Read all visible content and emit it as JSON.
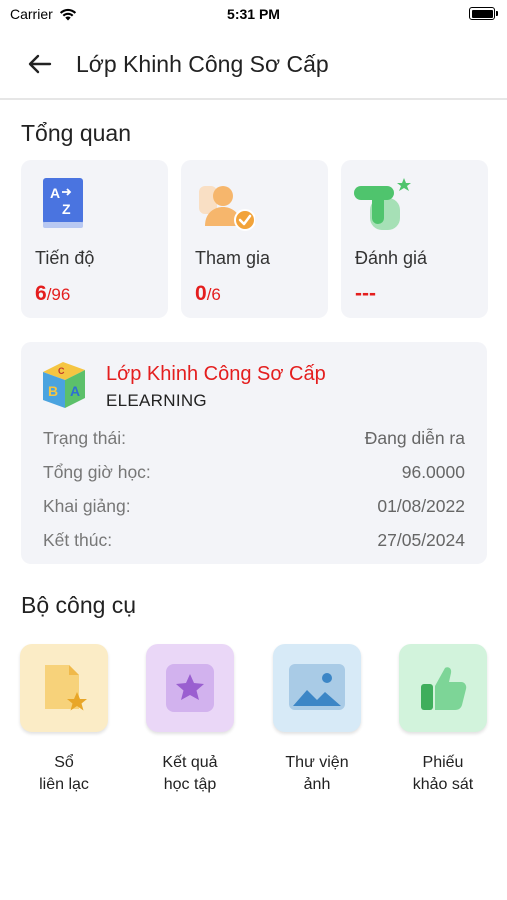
{
  "status_bar": {
    "carrier": "Carrier",
    "time": "5:31 PM"
  },
  "header": {
    "title": "Lớp Khinh Công Sơ Cấp"
  },
  "overview": {
    "title": "Tổng quan",
    "cards": [
      {
        "icon": "az-book-icon",
        "label": "Tiến độ",
        "value": "6",
        "total": "/96"
      },
      {
        "icon": "user-check-icon",
        "label": "Tham gia",
        "value": "0",
        "total": "/6"
      },
      {
        "icon": "hand-star-icon",
        "label": "Đánh giá",
        "value": "---",
        "total": ""
      }
    ]
  },
  "class_info": {
    "name": "Lớp Khinh Công Sơ Cấp",
    "type": "ELEARNING",
    "rows": [
      {
        "label": "Trạng thái:",
        "value": "Đang diễn ra"
      },
      {
        "label": "Tổng giờ học:",
        "value": "96.0000"
      },
      {
        "label": "Khai giảng:",
        "value": "01/08/2022"
      },
      {
        "label": "Kết thúc:",
        "value": "27/05/2024"
      }
    ]
  },
  "tools": {
    "title": "Bộ công cụ",
    "items": [
      {
        "line1": "Sổ",
        "line2": "liên lạc",
        "icon": "notebook-star-icon",
        "color": "#fbecc6"
      },
      {
        "line1": "Kết quả",
        "line2": "học tập",
        "icon": "star-badge-icon",
        "color": "#ead7f7"
      },
      {
        "line1": "Thư viện",
        "line2": "ảnh",
        "icon": "image-icon",
        "color": "#d7eaf7"
      },
      {
        "line1": "Phiếu",
        "line2": "khảo sát",
        "icon": "thumbs-up-icon",
        "color": "#d2f3dc"
      }
    ]
  },
  "colors": {
    "accent": "#e41e1e",
    "card_bg": "#f3f4f8"
  }
}
